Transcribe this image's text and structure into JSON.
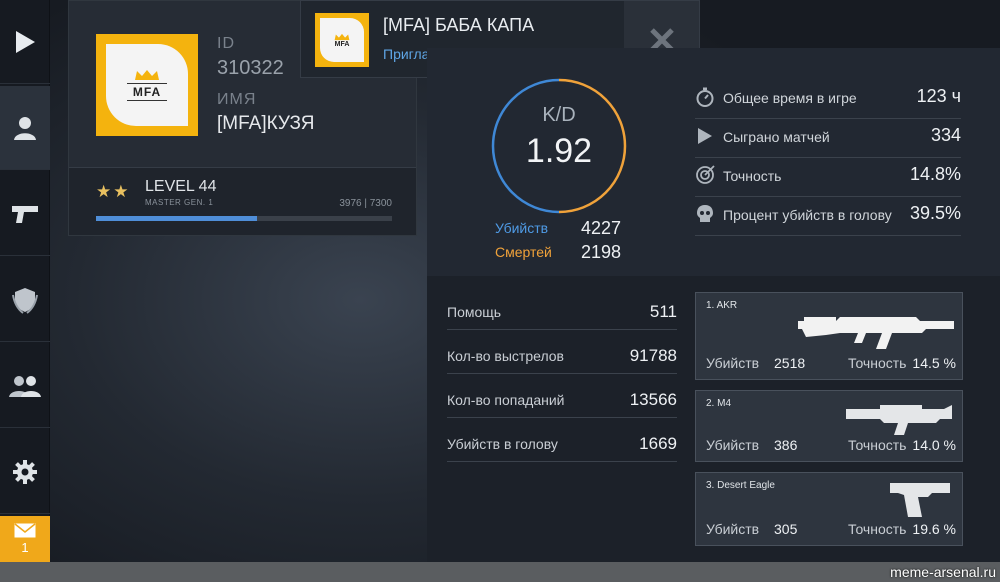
{
  "notification": {
    "title": "[MFA] БАБА КАПА",
    "subtitle": "Приглашает в лобби",
    "close_icon": "close-icon"
  },
  "profile": {
    "logo_text": "MFA",
    "id_label": "ID",
    "id_value": "310322",
    "name_label": "ИМЯ",
    "name_value": "[MFA]КУЗЯ",
    "stars": "★★",
    "level": "LEVEL 44",
    "rank": "MASTER GEN. 1",
    "xp": "3976 | 7300",
    "xp_progress": 0.545
  },
  "sidebar": {
    "items": [
      {
        "icon": "play-icon"
      },
      {
        "icon": "user-icon"
      },
      {
        "icon": "pistol-icon"
      },
      {
        "icon": "emblem-icon"
      },
      {
        "icon": "friends-icon"
      },
      {
        "icon": "gear-icon"
      }
    ],
    "mail_icon": "mail-icon",
    "mail_count": "1"
  },
  "kd": {
    "label": "K/D",
    "value": "1.92",
    "kills_label": "Убийств",
    "kills_value": "4227",
    "deaths_label": "Смертей",
    "deaths_value": "2198",
    "kills_color": "#4f9be6",
    "deaths_color": "#f0a23a"
  },
  "summary": [
    {
      "icon": "stopwatch-icon",
      "label": "Общее время в игре",
      "value": "123 ч"
    },
    {
      "icon": "play-icon",
      "label": "Сыграно матчей",
      "value": "334"
    },
    {
      "icon": "target-icon",
      "label": "Точность",
      "value": "14.8%"
    },
    {
      "icon": "skull-icon",
      "label": "Процент убийств в голову",
      "value": "39.5%"
    }
  ],
  "details": [
    {
      "label": "Помощь",
      "value": "511"
    },
    {
      "label": "Кол-во выстрелов",
      "value": "91788"
    },
    {
      "label": "Кол-во попаданий",
      "value": "13566"
    },
    {
      "label": "Убийств в голову",
      "value": "1669"
    }
  ],
  "weapons": [
    {
      "name": "1. AKR",
      "kills_label": "Убийств",
      "kills": "2518",
      "acc_label": "Точность",
      "acc": "14.5 %",
      "icon": "rifle-akr-icon"
    },
    {
      "name": "2. M4",
      "kills_label": "Убийств",
      "kills": "386",
      "acc_label": "Точность",
      "acc": "14.0 %",
      "icon": "rifle-m4-icon"
    },
    {
      "name": "3. Desert Eagle",
      "kills_label": "Убийств",
      "kills": "305",
      "acc_label": "Точность",
      "acc": "19.6 %",
      "icon": "pistol-deagle-icon"
    }
  ],
  "watermark": "meme-arsenal.ru"
}
